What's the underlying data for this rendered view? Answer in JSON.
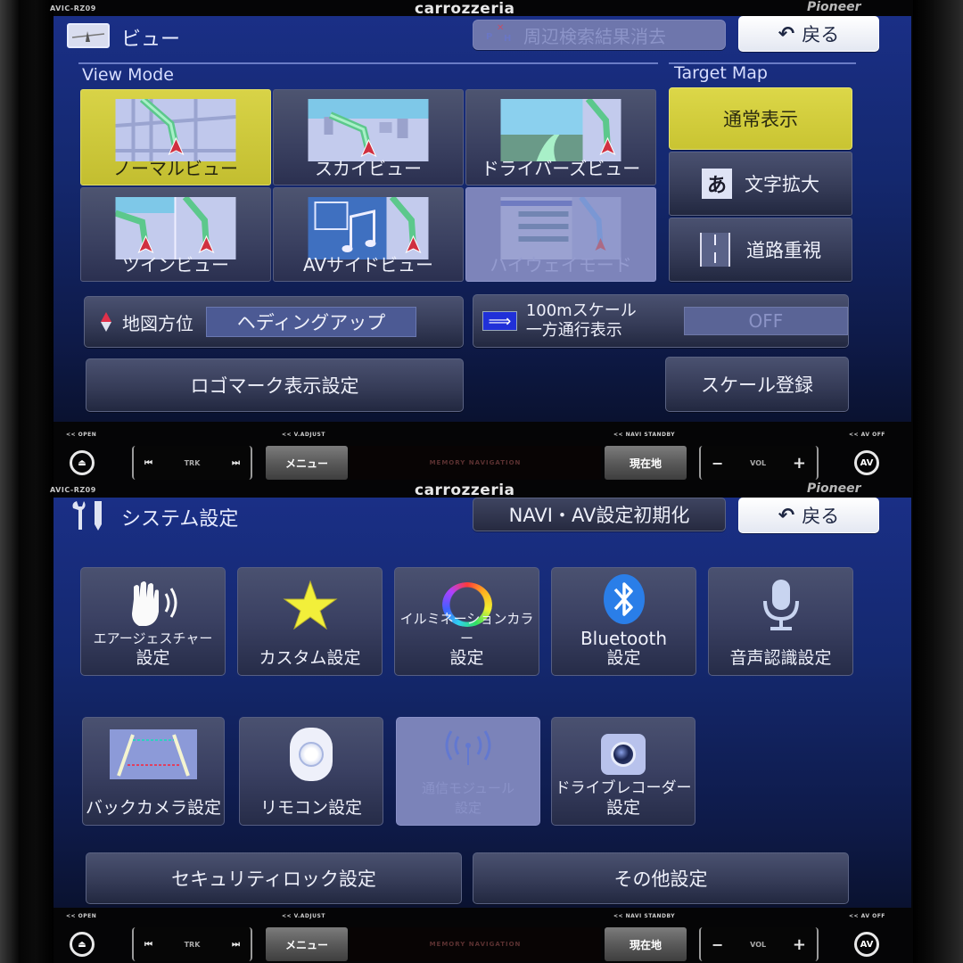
{
  "device": {
    "model": "AVIC-RZ09",
    "brand": "carrozzeria",
    "maker": "Pioneer",
    "hints": {
      "open": "<< OPEN",
      "v_adjust": "<< V.ADJUST",
      "navi_standby": "<< NAVI STANDBY",
      "av_off": "<< AV OFF"
    },
    "hw_buttons": {
      "trk": "TRK",
      "menu": "メニュー",
      "center_label": "MEMORY NAVIGATION",
      "current_location": "現在地",
      "vol_minus": "−",
      "vol": "VOL",
      "vol_plus": "+",
      "av": "AV",
      "eject_icon": "eject-icon",
      "prev_icon": "skip-previous-icon",
      "next_icon": "skip-next-icon"
    }
  },
  "view_screen": {
    "title": "ビュー",
    "title_icon": "map-view-icon",
    "nearby_search_clear": "周辺検索結果消去",
    "back": "戻る",
    "back_icon": "back-arrow-icon",
    "view_mode_label": "View Mode",
    "target_map_label": "Target Map",
    "view_modes": [
      {
        "label": "ノーマルビュー",
        "state": "selected"
      },
      {
        "label": "スカイビュー",
        "state": "normal"
      },
      {
        "label": "ドライバーズビュー",
        "state": "normal"
      },
      {
        "label": "ツインビュー",
        "state": "normal"
      },
      {
        "label": "AVサイドビュー",
        "state": "normal"
      },
      {
        "label": "ハイウェイモード",
        "state": "disabled"
      }
    ],
    "target_maps": [
      {
        "label": "通常表示",
        "state": "selected"
      },
      {
        "label": "文字拡大",
        "icon_glyph": "あ",
        "state": "normal"
      },
      {
        "label": "道路重視",
        "state": "normal"
      }
    ],
    "map_orientation": {
      "label": "地図方位",
      "value": "ヘディングアップ"
    },
    "one_way": {
      "line1": "100mスケール",
      "line2": "一方通行表示",
      "value": "OFF"
    },
    "logo_mark": "ロゴマーク表示設定",
    "scale_register": "スケール登録"
  },
  "system_screen": {
    "title": "システム設定",
    "title_icon": "wrench-pencil-icon",
    "reset": "NAVI・AV設定初期化",
    "back": "戻る",
    "tiles_row1": [
      {
        "line1": "エアージェスチャー",
        "line2": "設定",
        "icon": "hand-gesture-icon",
        "state": "normal"
      },
      {
        "line1": "カスタム設定",
        "line2": "",
        "icon": "star-icon",
        "state": "normal"
      },
      {
        "line1": "イルミネーションカラー",
        "line2": "設定",
        "icon": "color-ring-icon",
        "state": "normal"
      },
      {
        "line1": "Bluetooth",
        "line2": "設定",
        "icon": "bluetooth-icon",
        "state": "normal"
      },
      {
        "line1": "音声認識設定",
        "line2": "",
        "icon": "microphone-icon",
        "state": "normal"
      }
    ],
    "tiles_row2": [
      {
        "line1": "バックカメラ設定",
        "line2": "",
        "icon": "back-camera-icon",
        "state": "normal"
      },
      {
        "line1": "リモコン設定",
        "line2": "",
        "icon": "remote-control-icon",
        "state": "normal"
      },
      {
        "line1": "通信モジュール",
        "line2": "設定",
        "icon": "antenna-signal-icon",
        "state": "disabled"
      },
      {
        "line1": "ドライブレコーダー",
        "line2": "設定",
        "icon": "dashcam-icon",
        "state": "normal"
      }
    ],
    "security_lock": "セキュリティロック設定",
    "other": "その他設定"
  }
}
